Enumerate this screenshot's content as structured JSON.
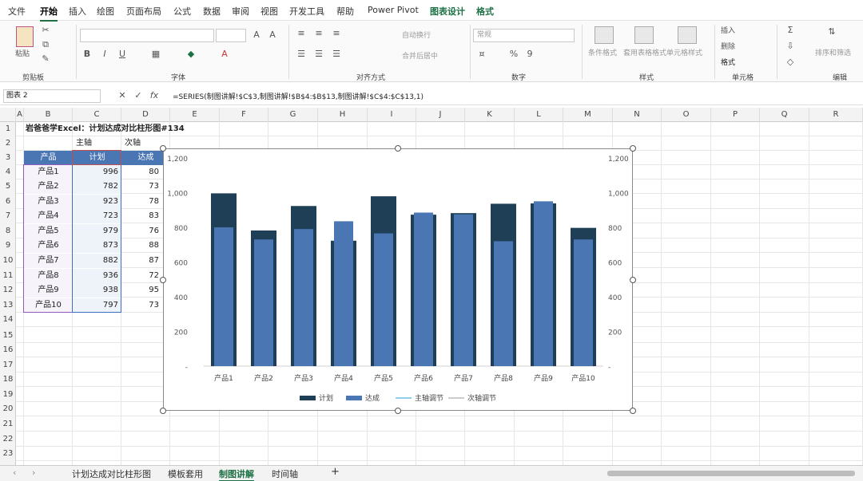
{
  "menu": {
    "tabs": [
      "文件",
      "开始",
      "插入",
      "绘图",
      "页面布局",
      "公式",
      "数据",
      "审阅",
      "视图",
      "开发工具",
      "帮助",
      "Power Pivot",
      "图表设计",
      "格式"
    ]
  },
  "ribbon": {
    "paste": "粘贴",
    "clipboard": "剪贴板",
    "font": "字体",
    "alignment": "对齐方式",
    "number": "数字",
    "styles": "样式",
    "cells": "单元格",
    "editing": "编辑",
    "wrap": "自动换行",
    "merge": "合并后居中",
    "numfmt": "常规",
    "cond": "条件格式",
    "table": "套用表格格式",
    "cellstyle": "单元格样式",
    "insert": "插入",
    "delete": "删除",
    "format": "格式",
    "sort": "排序和筛选"
  },
  "formula": {
    "namebox": "图表 2",
    "fx": "fx",
    "text": "=SERIES(制图讲解!$C$3,制图讲解!$B$4:$B$13,制图讲解!$C$4:$C$13,1)"
  },
  "columns": [
    "A",
    "B",
    "C",
    "D",
    "E",
    "F",
    "G",
    "H",
    "I",
    "J",
    "K",
    "L",
    "M",
    "N",
    "O",
    "P",
    "Q",
    "R"
  ],
  "rows": [
    "1",
    "2",
    "3",
    "4",
    "5",
    "6",
    "7",
    "8",
    "9",
    "10",
    "11",
    "12",
    "13",
    "14",
    "15",
    "16",
    "17",
    "18",
    "19",
    "20",
    "21",
    "22",
    "23"
  ],
  "sheet": {
    "title": "岩爸爸学Excel：计划达成对比柱形图#134",
    "primary": "主轴",
    "secondary": "次轴",
    "headers": [
      "产品",
      "计划",
      "达成"
    ],
    "rows": [
      [
        "产品1",
        "996",
        "80"
      ],
      [
        "产品2",
        "782",
        "73"
      ],
      [
        "产品3",
        "923",
        "78"
      ],
      [
        "产品4",
        "723",
        "83"
      ],
      [
        "产品5",
        "979",
        "76"
      ],
      [
        "产品6",
        "873",
        "88"
      ],
      [
        "产品7",
        "882",
        "87"
      ],
      [
        "产品8",
        "936",
        "72"
      ],
      [
        "产品9",
        "938",
        "95"
      ],
      [
        "产品10",
        "797",
        "73"
      ]
    ]
  },
  "chart_data": {
    "type": "bar",
    "categories": [
      "产品1",
      "产品2",
      "产品3",
      "产品4",
      "产品5",
      "产品6",
      "产品7",
      "产品8",
      "产品9",
      "产品10"
    ],
    "series": [
      {
        "name": "计划",
        "values": [
          996,
          782,
          923,
          723,
          979,
          873,
          882,
          936,
          938,
          797
        ],
        "color": "#1f3f57"
      },
      {
        "name": "达成",
        "values": [
          800,
          730,
          790,
          835,
          765,
          885,
          875,
          720,
          950,
          730
        ],
        "color": "#4a76b4"
      }
    ],
    "legend": [
      "计划",
      "达成",
      "主轴调节",
      "次轴调节"
    ],
    "legend_colors": [
      "#1f3f57",
      "#4a76b4",
      "#6fbde6",
      "#bbbbbb"
    ],
    "ylim": [
      0,
      1200
    ],
    "yticks": [
      "1,200",
      "1,000",
      "800",
      "600",
      "400",
      "200",
      "-"
    ],
    "legend_position": "bottom"
  },
  "tabs": {
    "items": [
      "计划达成对比柱形图",
      "模板套用",
      "制图讲解",
      "时间轴"
    ],
    "active": 2,
    "add": "+"
  }
}
